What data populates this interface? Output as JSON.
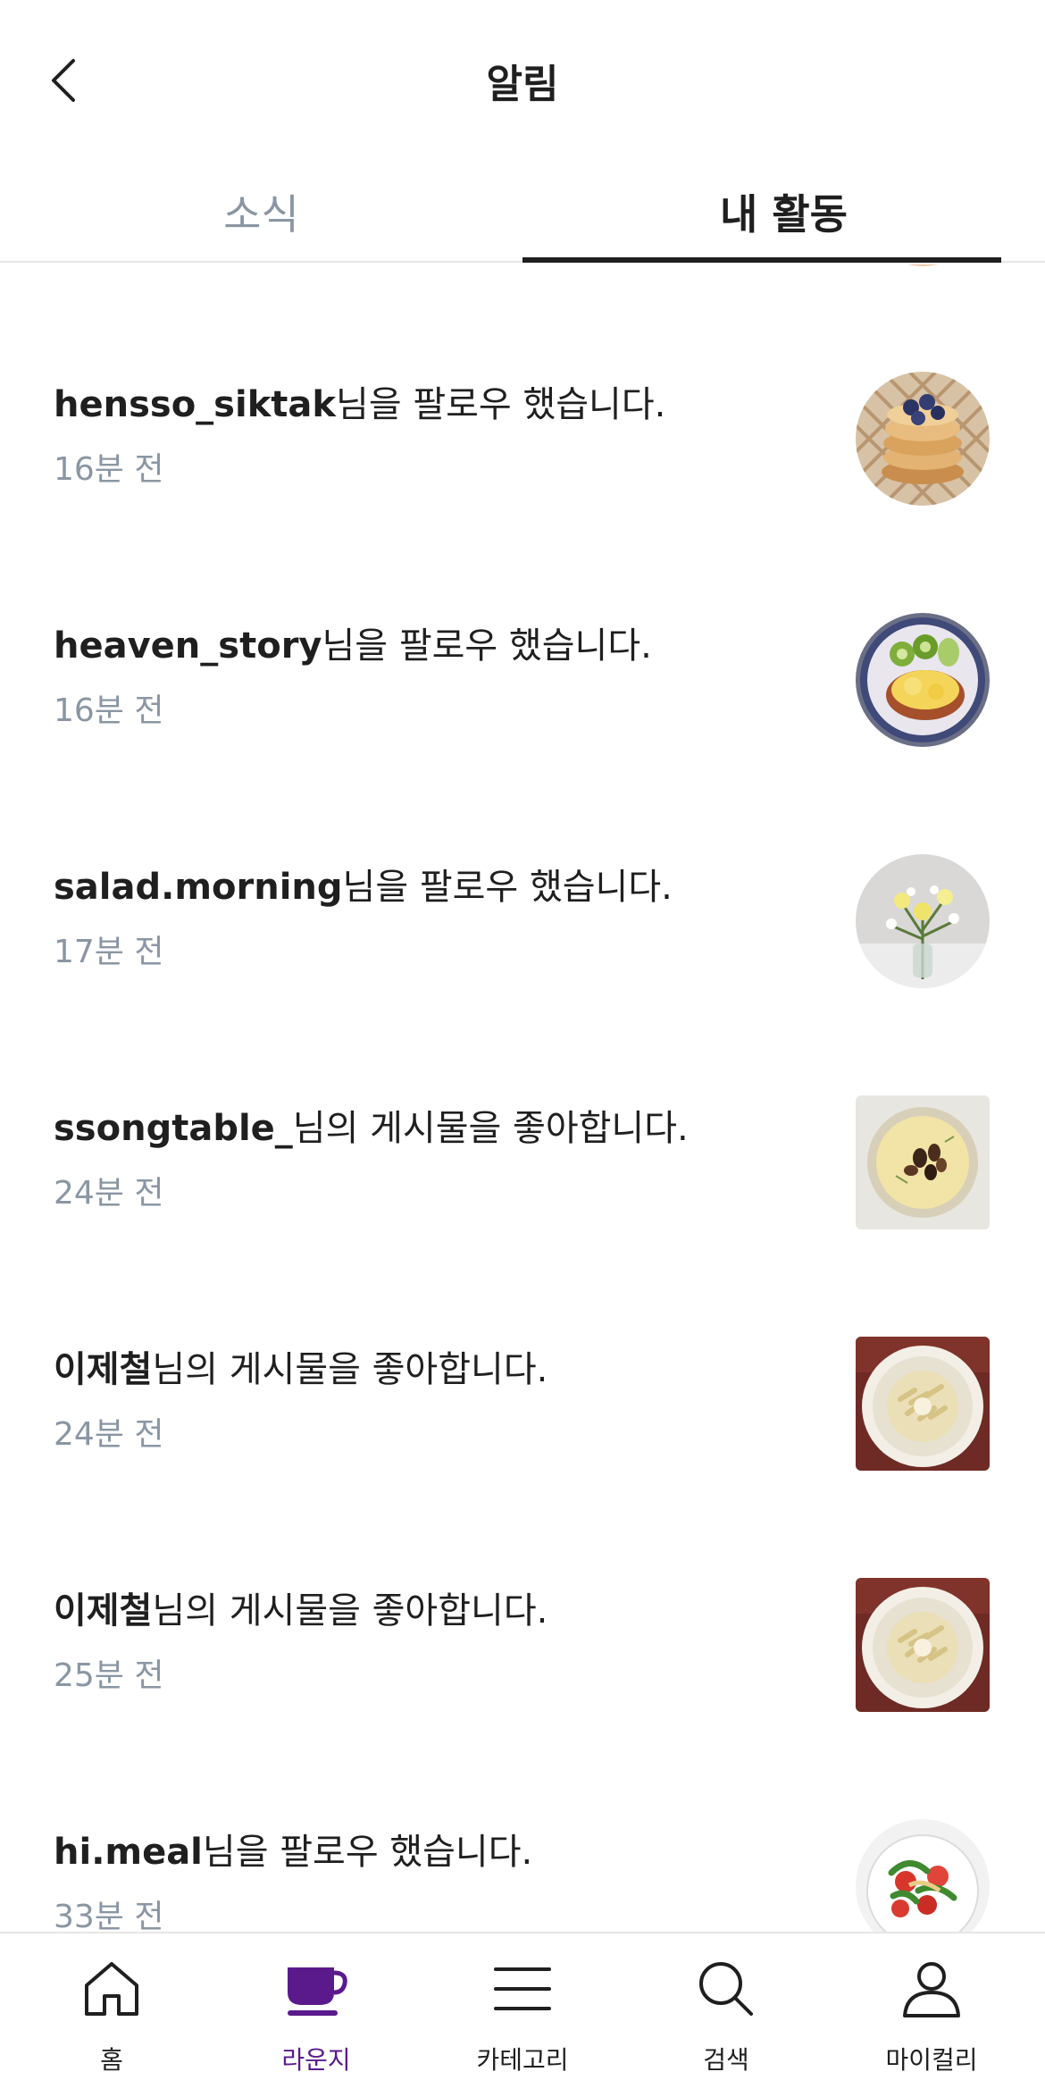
{
  "header": {
    "title": "알림",
    "back_icon": "chevron-left-icon"
  },
  "tabs": [
    {
      "label": "소식",
      "active": false
    },
    {
      "label": "내 활동",
      "active": true
    }
  ],
  "notifications": [
    {
      "username": "hensso_siktak",
      "message": "님을 팔로우 했습니다.",
      "time": "16분 전",
      "thumbnail": "pancakes-avatar"
    },
    {
      "username": "heaven_story",
      "message": "님을 팔로우 했습니다.",
      "time": "16분 전",
      "thumbnail": "breakfast-plate-avatar"
    },
    {
      "username": "salad.morning",
      "message": "님을 팔로우 했습니다.",
      "time": "17분 전",
      "thumbnail": "flowers-avatar"
    },
    {
      "username": "ssongtable_",
      "message": "님의 게시물을 좋아합니다.",
      "time": "24분 전",
      "thumbnail": "soup-bowl-post"
    },
    {
      "username": "이제철",
      "message": "님의 게시물을 좋아합니다.",
      "time": "24분 전",
      "thumbnail": "pasta-post"
    },
    {
      "username": "이제철",
      "message": "님의 게시물을 좋아합니다.",
      "time": "25분 전",
      "thumbnail": "pasta-post"
    },
    {
      "username": "hi.meal",
      "message": "님을 팔로우 했습니다.",
      "time": "33분 전",
      "thumbnail": "salad-avatar"
    }
  ],
  "bottom_nav": [
    {
      "label": "홈",
      "icon": "home-icon",
      "active": false
    },
    {
      "label": "라운지",
      "icon": "coffee-cup-icon",
      "active": true
    },
    {
      "label": "카테고리",
      "icon": "menu-icon",
      "active": false
    },
    {
      "label": "검색",
      "icon": "search-icon",
      "active": false
    },
    {
      "label": "마이컬리",
      "icon": "user-icon",
      "active": false
    }
  ],
  "colors": {
    "accent": "#5b1a8c",
    "muted": "#8a96a3",
    "text": "#1f1f1f"
  }
}
